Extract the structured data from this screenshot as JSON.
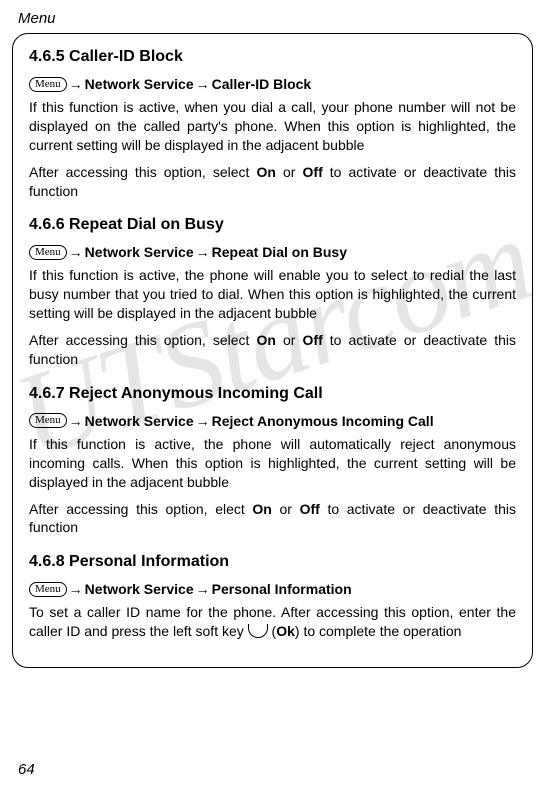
{
  "header": "Menu",
  "page_number": "64",
  "watermark": "UTStarcom",
  "menu_label": "Menu",
  "arrow": "→",
  "sections": {
    "s1": {
      "title": "4.6.5 Caller-ID Block",
      "nav1": "Network Service",
      "nav2": "Caller-ID Block",
      "p1a": "If this function is active, when you dial a call, your phone number will not be displayed on the called party's phone. When this option is highlighted, the current setting will be displayed in the adjacent bubble",
      "p2a": "After accessing this option, select ",
      "p2b": "On",
      "p2c": " or ",
      "p2d": "Off",
      "p2e": " to activate or deactivate this function"
    },
    "s2": {
      "title": "4.6.6 Repeat Dial on Busy",
      "nav1": "Network Service",
      "nav2": "Repeat Dial on Busy",
      "p1a": "If this function is active, the phone will enable you to select to redial the last busy number that you tried to dial. When this option is highlighted, the current setting will be displayed in the adjacent bubble",
      "p2a": "After accessing this option, select ",
      "p2b": "On",
      "p2c": " or ",
      "p2d": "Off",
      "p2e": " to activate or deactivate this function"
    },
    "s3": {
      "title": "4.6.7 Reject Anonymous Incoming Call",
      "nav1": "Network Service",
      "nav2": " Reject Anonymous Incoming Call",
      "p1a": "If this function is active, the phone will automatically reject anonymous incoming calls. When this option is highlighted, the current setting will be displayed in the adjacent bubble",
      "p2a": "After accessing this option, elect ",
      "p2b": "On",
      "p2c": " or ",
      "p2d": "Off",
      "p2e": " to activate or deactivate this function"
    },
    "s4": {
      "title": "4.6.8 Personal Information",
      "nav1": "Network Service",
      "nav2": "Personal Information",
      "p1a": "To set a caller ID name for the phone. After accessing this option, enter the caller ID and press the left soft key ",
      "p1b": " (",
      "p1c": "Ok",
      "p1d": ") to complete the operation"
    }
  }
}
